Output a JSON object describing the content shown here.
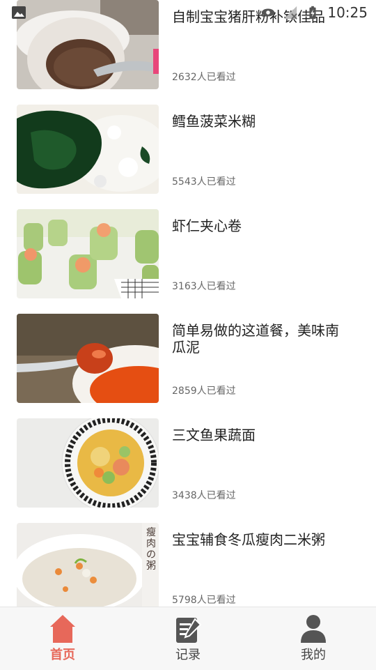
{
  "status_bar": {
    "time": "10:25",
    "icons": [
      "image-icon",
      "eye-off-icon",
      "signal-off-icon",
      "battery-charging-icon"
    ]
  },
  "list": {
    "items": [
      {
        "title": "自制宝宝猪肝粉补铁佳品",
        "views": "2632人已看过",
        "image": "pork-liver-powder-bowl"
      },
      {
        "title": "鳕鱼菠菜米糊",
        "views": "5543人已看过",
        "image": "spinach-rice-paste"
      },
      {
        "title": "虾仁夹心卷",
        "views": "3163人已看过",
        "image": "shrimp-cucumber-rolls"
      },
      {
        "title": "简单易做的这道餐，美味南瓜泥",
        "views": "2859人已看过",
        "image": "pumpkin-puree-spoon"
      },
      {
        "title": "三文鱼果蔬面",
        "views": "3438人已看过",
        "image": "salmon-vegetable-noodles"
      },
      {
        "title": "宝宝辅食冬瓜瘦肉二米粥",
        "views": "5798人已看过",
        "image": "winter-melon-porridge",
        "image_text": "瘦肉の粥"
      }
    ]
  },
  "tabbar": {
    "tabs": [
      {
        "label": "首页",
        "icon": "home-icon",
        "active": true
      },
      {
        "label": "记录",
        "icon": "note-edit-icon",
        "active": false
      },
      {
        "label": "我的",
        "icon": "person-icon",
        "active": false
      }
    ],
    "accent": "#e7685a",
    "inactive_icon": "#555555"
  }
}
